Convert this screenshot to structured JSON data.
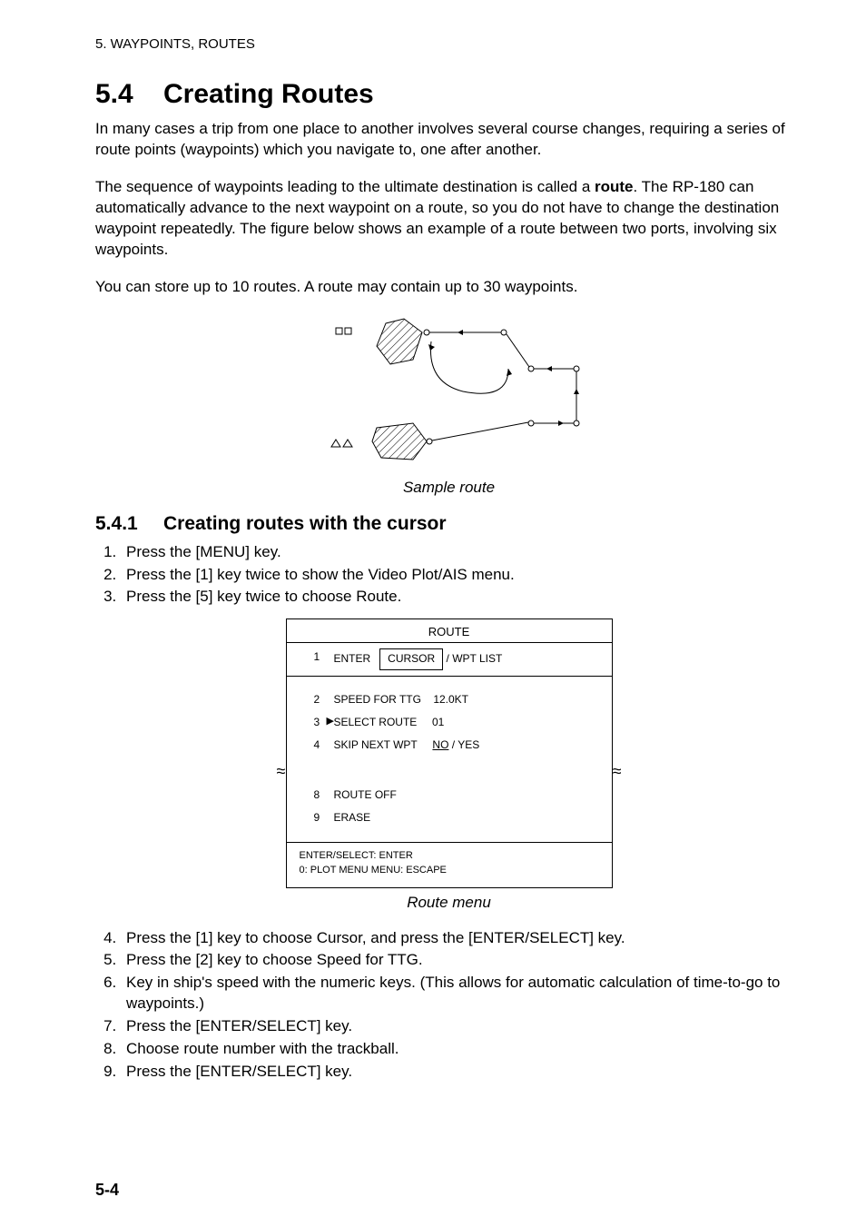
{
  "header": "5. WAYPOINTS, ROUTES",
  "section": {
    "number": "5.4",
    "title": "Creating Routes"
  },
  "para1": "In many cases a trip from one place to another involves several course changes, requiring a series of route points (waypoints) which you navigate to, one after another.",
  "para2a": "The sequence of waypoints leading to the ultimate destination is called a ",
  "para2b": "route",
  "para2c": ". The RP-180 can automatically advance to the next waypoint on a route, so you do not have to change the destination waypoint repeatedly. The figure below shows an example of a route between two ports, involving six waypoints.",
  "para3": "You can store up to 10 routes. A route may contain up to 30 waypoints.",
  "figure1_caption": "Sample route",
  "subsection": {
    "number": "5.4.1",
    "title": "Creating routes with the cursor"
  },
  "steps_a": [
    "Press the [MENU] key.",
    "Press the [1] key twice to show the Video Plot/AIS menu.",
    "Press the [5] key twice to choose Route."
  ],
  "menu": {
    "title": "ROUTE",
    "item1_num": "1",
    "item1_label": "ENTER",
    "item1_value": "CURSOR",
    "item1_alt": " / WPT LIST",
    "item2_num": "2",
    "item2_label": "SPEED FOR TTG",
    "item2_value": "12.0KT",
    "item3_num": "3",
    "item3_label": "SELECT ROUTE",
    "item3_value": "01",
    "item4_num": "4",
    "item4_label": "SKIP NEXT WPT",
    "item4_value": "NO",
    "item4_alt": " / YES",
    "item8_num": "8",
    "item8_label": "ROUTE OFF",
    "item9_num": "9",
    "item9_label": "ERASE",
    "footer1": "ENTER/SELECT: ENTER",
    "footer2": "0: PLOT MENU   MENU: ESCAPE"
  },
  "figure2_caption": "Route menu",
  "steps_b": [
    "Press the [1] key to choose Cursor, and press the [ENTER/SELECT] key.",
    "Press the [2] key to choose Speed for TTG.",
    "Key in ship's speed with the numeric keys. (This allows for automatic calculation of time-to-go to waypoints.)",
    "Press the [ENTER/SELECT] key.",
    "Choose route number with the trackball.",
    "Press the [ENTER/SELECT] key."
  ],
  "page_num": "5-4"
}
